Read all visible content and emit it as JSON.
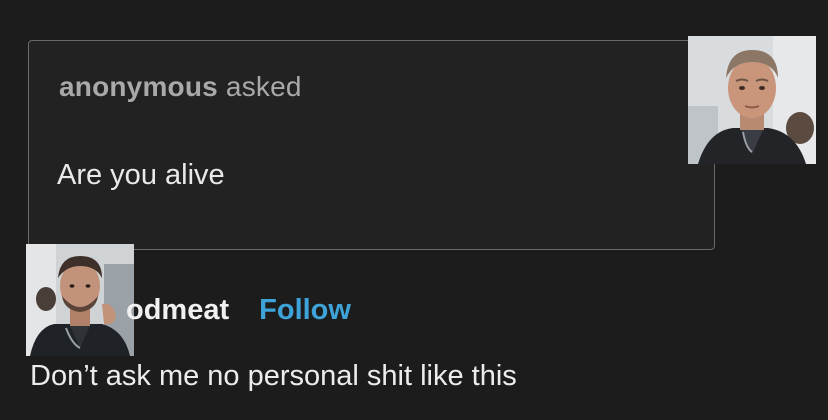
{
  "ask": {
    "asker": "anonymous",
    "verb": "asked",
    "question": "Are you alive"
  },
  "answer": {
    "blog_name": "odmeat",
    "follow_label": "Follow",
    "text": "Don’t ask me no personal shit like this"
  },
  "colors": {
    "background": "#1c1c1c",
    "follow": "#3ea3d8",
    "border": "#6a6a6a"
  }
}
